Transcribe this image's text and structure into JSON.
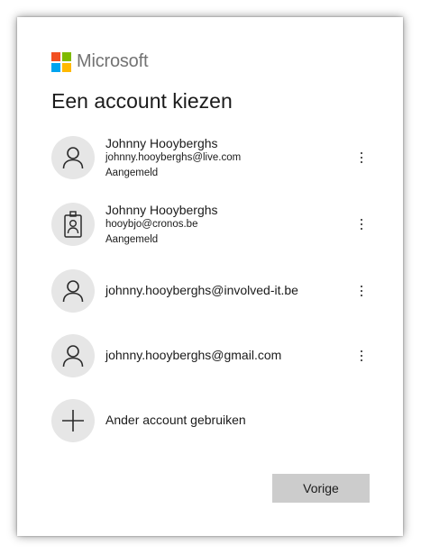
{
  "brand": {
    "name": "Microsoft",
    "logo_colors": [
      "#f25022",
      "#7fba00",
      "#00a4ef",
      "#ffb900"
    ]
  },
  "title": "Een account kiezen",
  "accounts": [
    {
      "name": "Johnny Hooyberghs",
      "email": "johnny.hooyberghs@live.com",
      "status": "Aangemeld",
      "icon": "person-icon"
    },
    {
      "name": "Johnny Hooyberghs",
      "email": "hooybjo@cronos.be",
      "status": "Aangemeld",
      "icon": "work-badge-icon"
    },
    {
      "email": "johnny.hooyberghs@involved-it.be",
      "icon": "person-icon"
    },
    {
      "email": "johnny.hooyberghs@gmail.com",
      "icon": "person-icon"
    }
  ],
  "other_account": {
    "label": "Ander account gebruiken",
    "icon": "plus-icon"
  },
  "back_button": {
    "label": "Vorige"
  },
  "colors": {
    "avatar_bg": "#e6e6e6",
    "button_bg": "#cccccc",
    "brand_text": "#737373"
  }
}
